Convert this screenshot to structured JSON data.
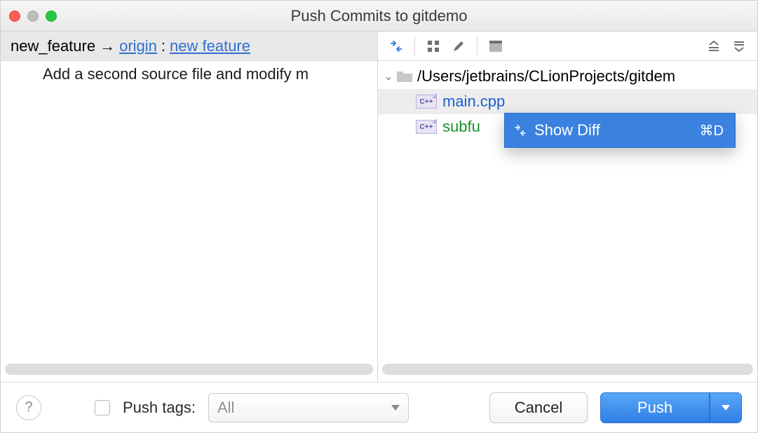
{
  "window": {
    "title": "Push Commits to gitdemo"
  },
  "branch": {
    "local": "new_feature",
    "remote": "origin",
    "remote_branch": "new feature"
  },
  "commit": {
    "message": "Add a second source file and modify m"
  },
  "tree": {
    "root_path": "/Users/jetbrains/CLionProjects/gitdem",
    "files": [
      {
        "name": "main.cpp",
        "status": "modified"
      },
      {
        "name": "subfu",
        "status": "added"
      }
    ]
  },
  "context_menu": {
    "items": [
      {
        "label": "Show Diff",
        "shortcut": "⌘D"
      }
    ]
  },
  "footer": {
    "push_tags_label": "Push tags:",
    "tags_filter": "All",
    "cancel": "Cancel",
    "push": "Push"
  },
  "icons": {
    "cpp_badge": "C++"
  }
}
